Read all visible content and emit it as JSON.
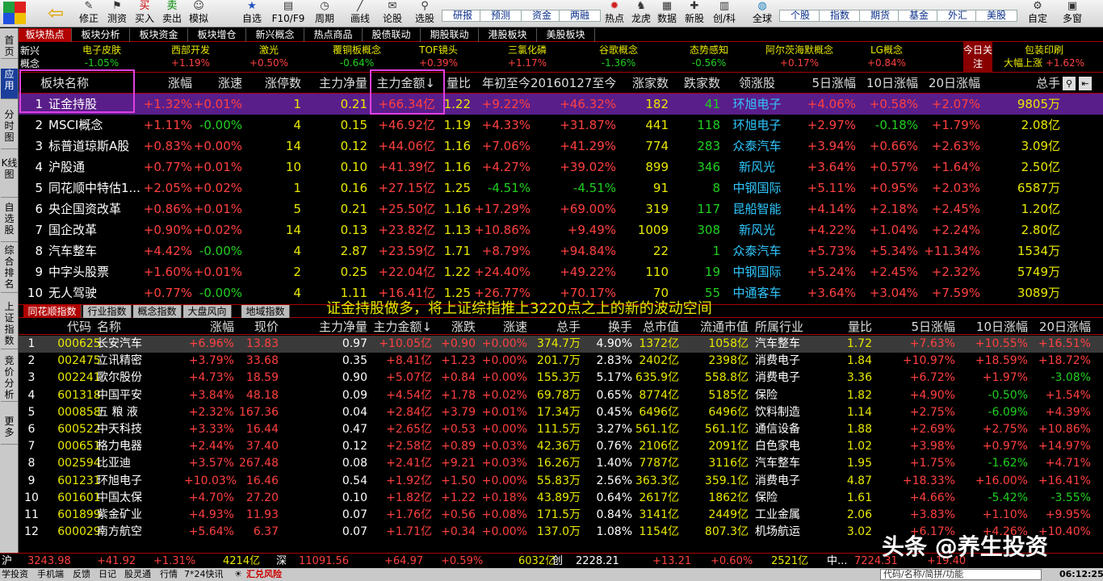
{
  "toolbar": {
    "tools": [
      {
        "label": "修正",
        "icon": "wrench-icon",
        "glyph": "✎"
      },
      {
        "label": "测资",
        "icon": "flag-icon",
        "glyph": "⚑"
      },
      {
        "label": "买入",
        "icon": "buy-icon",
        "glyph": "买"
      },
      {
        "label": "卖出",
        "icon": "sell-icon",
        "glyph": "卖"
      },
      {
        "label": "模拟",
        "icon": "person-icon",
        "glyph": "☺"
      },
      {
        "label": "自选",
        "icon": "star-icon",
        "glyph": "★"
      },
      {
        "label": "F10/F9",
        "icon": "doc-icon",
        "glyph": "▤"
      },
      {
        "label": "周期",
        "icon": "clock-icon",
        "glyph": "◷"
      },
      {
        "label": "画线",
        "icon": "pen-icon",
        "glyph": "╱"
      },
      {
        "label": "论股",
        "icon": "chat-icon",
        "glyph": "✉"
      },
      {
        "label": "选股",
        "icon": "filter-icon",
        "glyph": "⚲"
      }
    ],
    "buttons": [
      [
        "研报",
        "预测"
      ],
      [
        "资金",
        "两融"
      ]
    ],
    "tools2": [
      {
        "label": "热点",
        "icon": "fire-icon",
        "glyph": "✹"
      },
      {
        "label": "龙虎",
        "icon": "dragon-icon",
        "glyph": "♞"
      },
      {
        "label": "数据",
        "icon": "data-icon",
        "glyph": "▦"
      },
      {
        "label": "新股",
        "icon": "new-icon",
        "glyph": "✚"
      },
      {
        "label": "创/科",
        "icon": "chart-icon",
        "glyph": "▥"
      },
      {
        "label": "全球",
        "icon": "globe-icon",
        "glyph": "◍"
      }
    ],
    "markets": [
      [
        "个股",
        "指数"
      ],
      [
        "期货",
        "基金"
      ],
      [
        "外汇",
        "美股"
      ]
    ],
    "right": [
      {
        "label": "自定",
        "icon": "custom-icon",
        "glyph": "⚙"
      },
      {
        "label": "多窗",
        "icon": "window-icon",
        "glyph": "▣"
      }
    ]
  },
  "left_tabs": [
    "首页",
    "应用",
    "分时图",
    "K线图",
    "自选股",
    "综合排名",
    "上证指数",
    "竞价分析",
    "更多"
  ],
  "category_tabs": [
    "板块热点",
    "板块分析",
    "板块资金",
    "板块增仓",
    "新兴概念",
    "热点商品",
    "股债联动",
    "期股联动",
    "港股板块",
    "美股板块"
  ],
  "ticker": {
    "label": "新兴概念",
    "items": [
      {
        "name": "电子皮肤",
        "change": "-1.05%",
        "dir": "dn"
      },
      {
        "name": "西部开发",
        "change": "+1.19%",
        "dir": "up"
      },
      {
        "name": "激光",
        "change": "+0.50%",
        "dir": "up"
      },
      {
        "name": "覆铜板概念",
        "change": "-0.64%",
        "dir": "dn"
      },
      {
        "name": "TOF镜头",
        "change": "+0.39%",
        "dir": "up"
      },
      {
        "name": "三氯化磷",
        "change": "+1.17%",
        "dir": "up"
      },
      {
        "name": "谷歌概念",
        "change": "-1.36%",
        "dir": "dn"
      },
      {
        "name": "态势感知",
        "change": "-0.56%",
        "dir": "dn"
      },
      {
        "name": "阿尔茨海默概念",
        "change": "+0.17%",
        "dir": "up"
      },
      {
        "name": "LG概念",
        "change": "+0.84%",
        "dir": "up"
      }
    ],
    "today_label": "今日关注",
    "today": {
      "name": "包装印刷",
      "sub": "大幅上涨",
      "change": "+1.62%"
    }
  },
  "upper_table": {
    "headers": [
      "板块名称",
      "涨幅",
      "涨速",
      "涨停数",
      "主力净量",
      "主力金额↓",
      "量比",
      "年初至今",
      "20160127至今",
      "涨家数",
      "跌家数",
      "领涨股",
      "5日涨幅",
      "10日涨幅",
      "20日涨幅",
      "总手"
    ],
    "rows": [
      [
        "1",
        "证金持股",
        "+1.32%",
        "+0.01%",
        "1",
        "0.21",
        "+66.34亿",
        "1.22",
        "+9.22%",
        "+46.32%",
        "182",
        "41",
        "环旭电子",
        "+4.06%",
        "+0.58%",
        "+2.07%",
        "9805万"
      ],
      [
        "2",
        "MSCI概念",
        "+1.11%",
        "-0.00%",
        "4",
        "0.15",
        "+46.92亿",
        "1.19",
        "+4.33%",
        "+31.87%",
        "441",
        "118",
        "环旭电子",
        "+2.97%",
        "-0.18%",
        "+1.79%",
        "2.08亿"
      ],
      [
        "3",
        "标普道琼斯A股",
        "+0.83%",
        "+0.00%",
        "14",
        "0.12",
        "+44.06亿",
        "1.16",
        "+7.06%",
        "+41.29%",
        "774",
        "283",
        "众泰汽车",
        "+3.94%",
        "+0.66%",
        "+2.63%",
        "3.09亿"
      ],
      [
        "4",
        "沪股通",
        "+0.77%",
        "+0.01%",
        "10",
        "0.10",
        "+41.39亿",
        "1.16",
        "+4.27%",
        "+39.02%",
        "899",
        "346",
        "新风光",
        "+3.64%",
        "+0.57%",
        "+1.64%",
        "2.50亿"
      ],
      [
        "5",
        "同花顺中特估1...",
        "+2.05%",
        "+0.02%",
        "1",
        "0.16",
        "+27.15亿",
        "1.25",
        "-4.51%",
        "-4.51%",
        "91",
        "8",
        "中钢国际",
        "+5.11%",
        "+0.95%",
        "+2.03%",
        "6587万"
      ],
      [
        "6",
        "央企国资改革",
        "+0.86%",
        "+0.01%",
        "5",
        "0.21",
        "+25.50亿",
        "1.16",
        "+17.29%",
        "+69.00%",
        "319",
        "117",
        "昆船智能",
        "+4.14%",
        "+2.18%",
        "+2.45%",
        "1.20亿"
      ],
      [
        "7",
        "国企改革",
        "+0.90%",
        "+0.02%",
        "14",
        "0.13",
        "+23.82亿",
        "1.13",
        "+10.86%",
        "+9.49%",
        "1009",
        "308",
        "新风光",
        "+4.22%",
        "+1.04%",
        "+2.24%",
        "2.80亿"
      ],
      [
        "8",
        "汽车整车",
        "+4.42%",
        "-0.00%",
        "4",
        "2.87",
        "+23.59亿",
        "1.71",
        "+8.79%",
        "+94.84%",
        "22",
        "1",
        "众泰汽车",
        "+5.73%",
        "+5.34%",
        "+11.34%",
        "1534万"
      ],
      [
        "9",
        "中字头股票",
        "+1.60%",
        "+0.01%",
        "2",
        "0.25",
        "+22.04亿",
        "1.22",
        "+24.40%",
        "+49.22%",
        "110",
        "19",
        "中钢国际",
        "+5.24%",
        "+2.45%",
        "+2.32%",
        "5749万"
      ],
      [
        "10",
        "无人驾驶",
        "+0.77%",
        "-0.00%",
        "4",
        "1.11",
        "+16.41亿",
        "1.25",
        "+26.77%",
        "+70.17%",
        "70",
        "55",
        "中通客车",
        "+3.64%",
        "+3.04%",
        "+7.59%",
        "3089万"
      ]
    ]
  },
  "sub_tabs": [
    "同花顺指数",
    "行业指数",
    "概念指数",
    "大盘风向",
    "地域指数"
  ],
  "banner": "证金持股做多，将上证综指推上3220点之上的新的波动空间",
  "lower_table": {
    "headers": [
      "代码",
      "名称",
      "涨幅",
      "现价",
      "主力净量",
      "主力金额↓",
      "涨跌",
      "涨速",
      "总手",
      "换手",
      "总市值",
      "流通市值",
      "所属行业",
      "量比",
      "5日涨幅",
      "10日涨幅",
      "20日涨幅"
    ],
    "rows": [
      [
        "1",
        "000625",
        "长安汽车",
        "+6.96%",
        "13.83",
        "0.97",
        "+10.05亿",
        "+0.90",
        "+0.00%",
        "374.7万",
        "4.90%",
        "1372亿",
        "1058亿",
        "汽车整车",
        "1.72",
        "+7.63%",
        "+10.55%",
        "+16.51%"
      ],
      [
        "2",
        "002475",
        "立讯精密",
        "+3.79%",
        "33.68",
        "0.35",
        "+8.41亿",
        "+1.23",
        "+0.00%",
        "201.7万",
        "2.83%",
        "2402亿",
        "2398亿",
        "消费电子",
        "1.84",
        "+10.97%",
        "+18.59%",
        "+18.72%"
      ],
      [
        "3",
        "002241",
        "歌尔股份",
        "+4.73%",
        "18.59",
        "0.90",
        "+5.07亿",
        "+0.84",
        "+0.00%",
        "155.3万",
        "5.17%",
        "635.9亿",
        "558.8亿",
        "消费电子",
        "3.36",
        "+6.72%",
        "+1.97%",
        "-3.08%"
      ],
      [
        "4",
        "601318",
        "中国平安",
        "+3.84%",
        "48.18",
        "0.09",
        "+4.54亿",
        "+1.78",
        "+0.02%",
        "69.78万",
        "0.65%",
        "8774亿",
        "5185亿",
        "保险",
        "1.82",
        "+4.90%",
        "-0.50%",
        "+1.54%"
      ],
      [
        "5",
        "000858",
        "五 粮 液",
        "+2.32%",
        "167.36",
        "0.04",
        "+2.84亿",
        "+3.79",
        "+0.01%",
        "17.34万",
        "0.45%",
        "6496亿",
        "6496亿",
        "饮料制造",
        "1.14",
        "+2.75%",
        "-6.09%",
        "+4.39%"
      ],
      [
        "6",
        "600522",
        "中天科技",
        "+3.33%",
        "16.44",
        "0.47",
        "+2.65亿",
        "+0.53",
        "+0.00%",
        "111.5万",
        "3.27%",
        "561.1亿",
        "561.1亿",
        "通信设备",
        "1.88",
        "+2.69%",
        "+2.75%",
        "+10.86%"
      ],
      [
        "7",
        "000651",
        "格力电器",
        "+2.44%",
        "37.40",
        "0.12",
        "+2.58亿",
        "+0.89",
        "+0.03%",
        "42.36万",
        "0.76%",
        "2106亿",
        "2091亿",
        "白色家电",
        "1.02",
        "+3.98%",
        "+0.97%",
        "+14.97%"
      ],
      [
        "8",
        "002594",
        "比亚迪",
        "+3.57%",
        "267.48",
        "0.08",
        "+2.41亿",
        "+9.21",
        "+0.03%",
        "16.26万",
        "1.40%",
        "7787亿",
        "3116亿",
        "汽车整车",
        "1.95",
        "+1.75%",
        "-1.62%",
        "+4.71%"
      ],
      [
        "9",
        "601231",
        "环旭电子",
        "+10.03%",
        "16.46",
        "0.54",
        "+1.92亿",
        "+1.50",
        "+0.00%",
        "55.83万",
        "2.56%",
        "363.3亿",
        "359.1亿",
        "消费电子",
        "4.87",
        "+18.33%",
        "+16.00%",
        "+16.41%"
      ],
      [
        "10",
        "601601",
        "中国太保",
        "+4.70%",
        "27.20",
        "0.10",
        "+1.82亿",
        "+1.22",
        "+0.18%",
        "43.89万",
        "0.64%",
        "2617亿",
        "1862亿",
        "保险",
        "1.61",
        "+4.66%",
        "-5.42%",
        "-3.55%"
      ],
      [
        "11",
        "601899",
        "紫金矿业",
        "+4.93%",
        "11.93",
        "0.07",
        "+1.76亿",
        "+0.56",
        "+0.08%",
        "171.5万",
        "0.84%",
        "3141亿",
        "2449亿",
        "工业金属",
        "2.06",
        "+3.83%",
        "+1.10%",
        "+9.95%"
      ],
      [
        "12",
        "600029",
        "南方航空",
        "+5.64%",
        "6.37",
        "0.07",
        "+1.71亿",
        "+0.34",
        "+0.00%",
        "137.0万",
        "1.08%",
        "1154亿",
        "807.3亿",
        "机场航运",
        "3.02",
        "+6.17%",
        "+4.26%",
        "+10.40%"
      ]
    ]
  },
  "status": [
    {
      "name": "沪",
      "vals": [
        "3243.98",
        "+41.92",
        "+1.31%",
        "4214亿"
      ]
    },
    {
      "name": "深",
      "vals": [
        "11091.56",
        "+64.97",
        "+0.59%",
        "6032亿"
      ]
    },
    {
      "name": "创",
      "vals": [
        "2228.21",
        "+13.21",
        "+0.60%",
        "2521亿"
      ]
    },
    {
      "name": "中...",
      "vals": [
        "7224.31",
        "+19.40"
      ]
    }
  ],
  "bottom": {
    "items": [
      "学投资",
      "手机端",
      "反馈",
      "日记",
      "股灵通",
      "行情",
      "7*24快讯"
    ],
    "alert": "汇兑风险",
    "search": "代码/名称/简拼/功能",
    "time": "06:12:25"
  },
  "watermark": "头条 @养生投资"
}
